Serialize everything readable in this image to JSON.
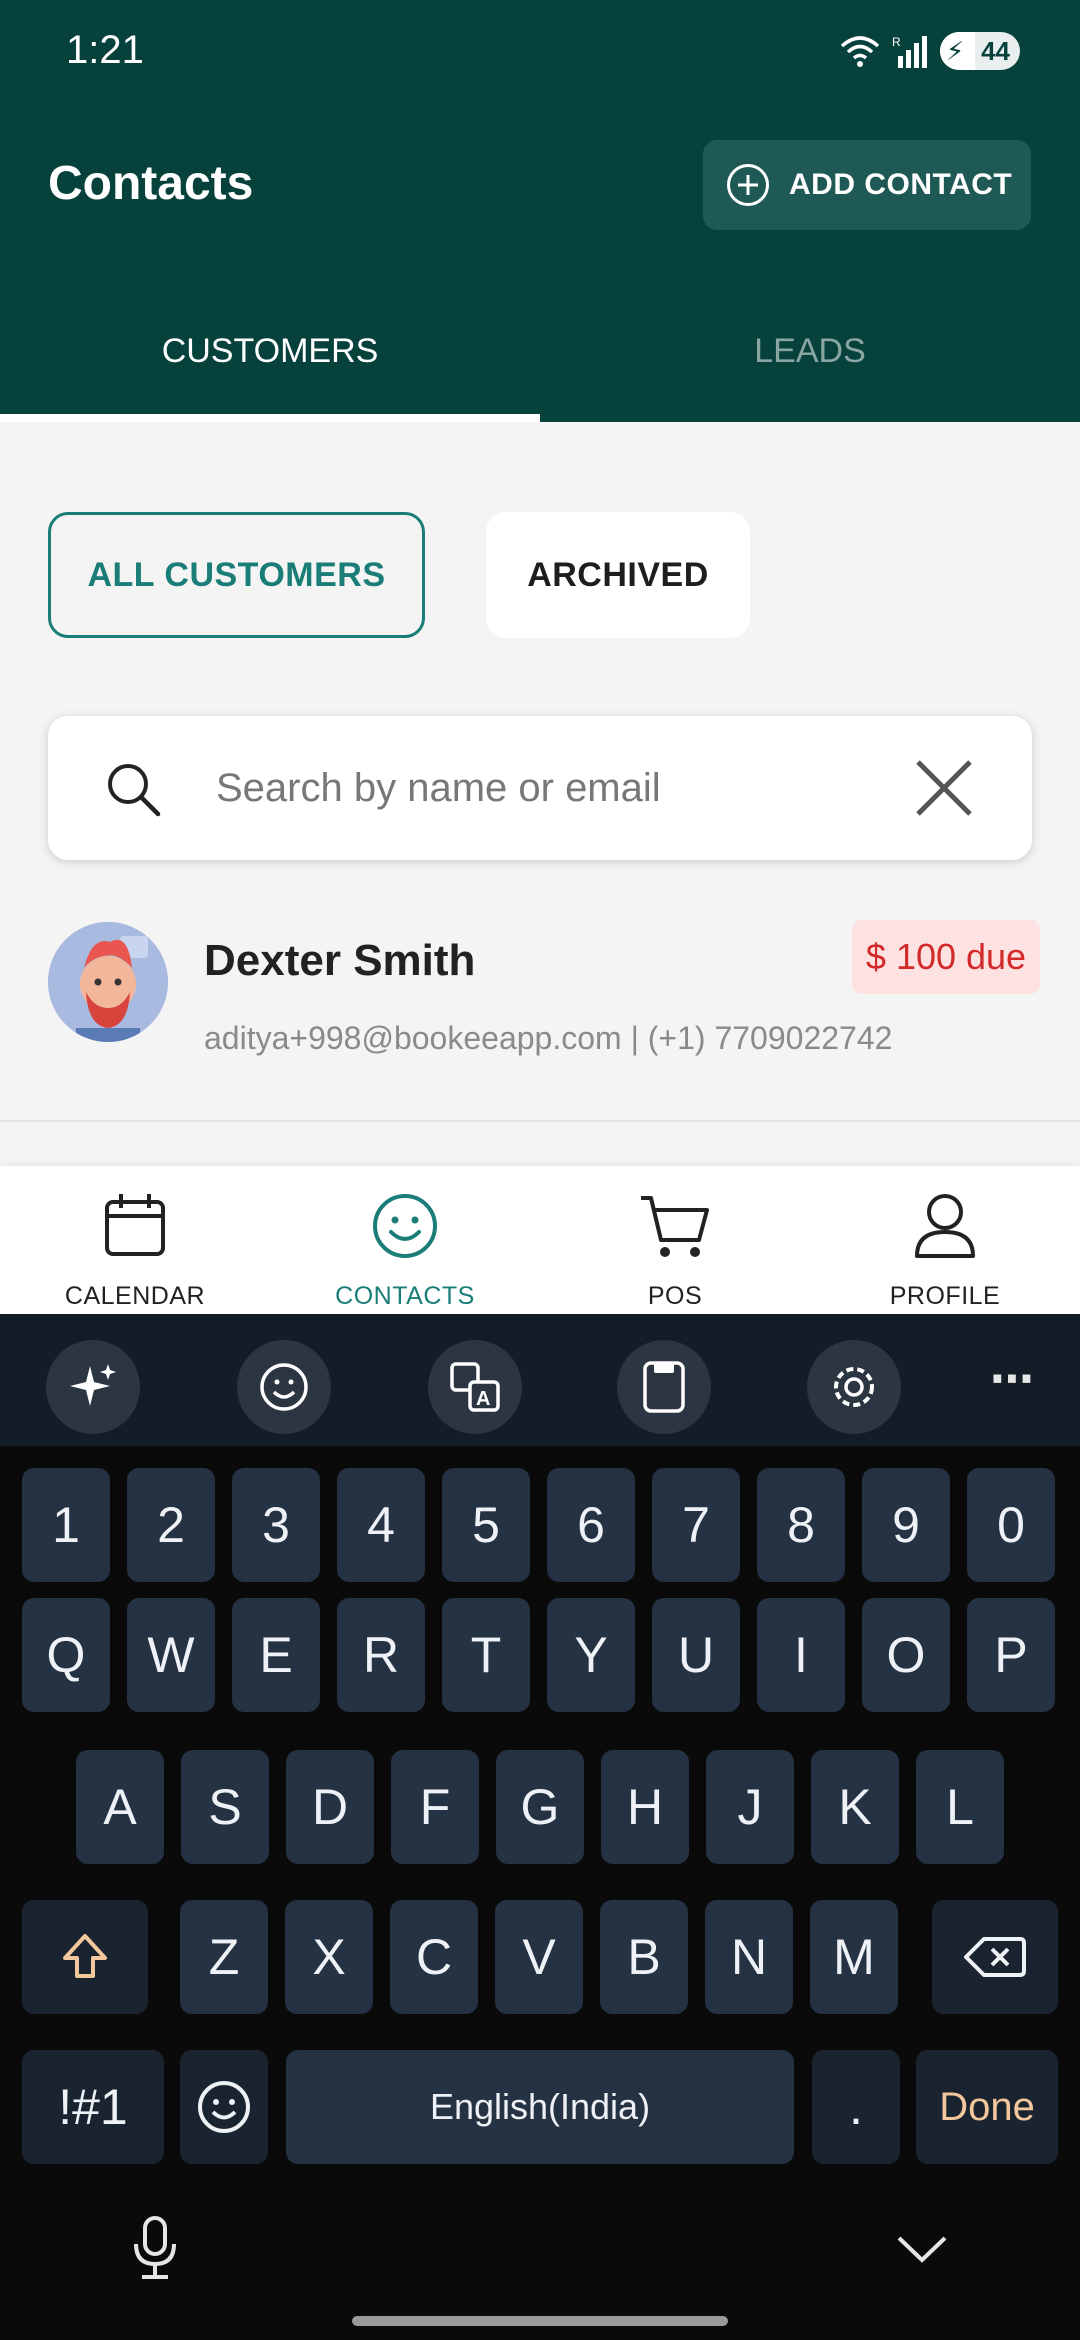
{
  "status_bar": {
    "time": "1:21",
    "battery": "44"
  },
  "header": {
    "title": "Contacts",
    "add_contact_label": "ADD CONTACT"
  },
  "tabs": [
    {
      "label": "CUSTOMERS",
      "active": true
    },
    {
      "label": "LEADS",
      "active": false
    }
  ],
  "filters": [
    {
      "label": "ALL CUSTOMERS",
      "selected": true
    },
    {
      "label": "ARCHIVED",
      "selected": false
    }
  ],
  "search": {
    "placeholder": "Search by name or email",
    "value": ""
  },
  "contacts": [
    {
      "name": "Dexter Smith",
      "subtitle": "aditya+998@bookeeapp.com | (+1) 7709022742",
      "due": "$ 100 due"
    }
  ],
  "bottom_nav": [
    {
      "label": "CALENDAR",
      "icon": "calendar-icon",
      "active": false
    },
    {
      "label": "CONTACTS",
      "icon": "smiley-icon",
      "active": true
    },
    {
      "label": "POS",
      "icon": "cart-icon",
      "active": false
    },
    {
      "label": "PROFILE",
      "icon": "person-icon",
      "active": false
    }
  ],
  "keyboard": {
    "toolbar_icons": [
      "sparkle-icon",
      "emoji-icon",
      "translate-icon",
      "clipboard-icon",
      "settings-icon",
      "more-icon"
    ],
    "row_numbers": [
      "1",
      "2",
      "3",
      "4",
      "5",
      "6",
      "7",
      "8",
      "9",
      "0"
    ],
    "row_1": [
      "Q",
      "W",
      "E",
      "R",
      "T",
      "Y",
      "U",
      "I",
      "O",
      "P"
    ],
    "row_2": [
      "A",
      "S",
      "D",
      "F",
      "G",
      "H",
      "J",
      "K",
      "L"
    ],
    "row_3": [
      "Z",
      "X",
      "C",
      "V",
      "B",
      "N",
      "M"
    ],
    "symbols_key": "!#1",
    "space_label": "English(India)",
    "period_key": ".",
    "done_key": "Done"
  },
  "colors": {
    "header_bg": "#07413c",
    "accent": "#1a7d77",
    "due_text": "#d22a2a",
    "due_bg": "#fde2e1"
  }
}
